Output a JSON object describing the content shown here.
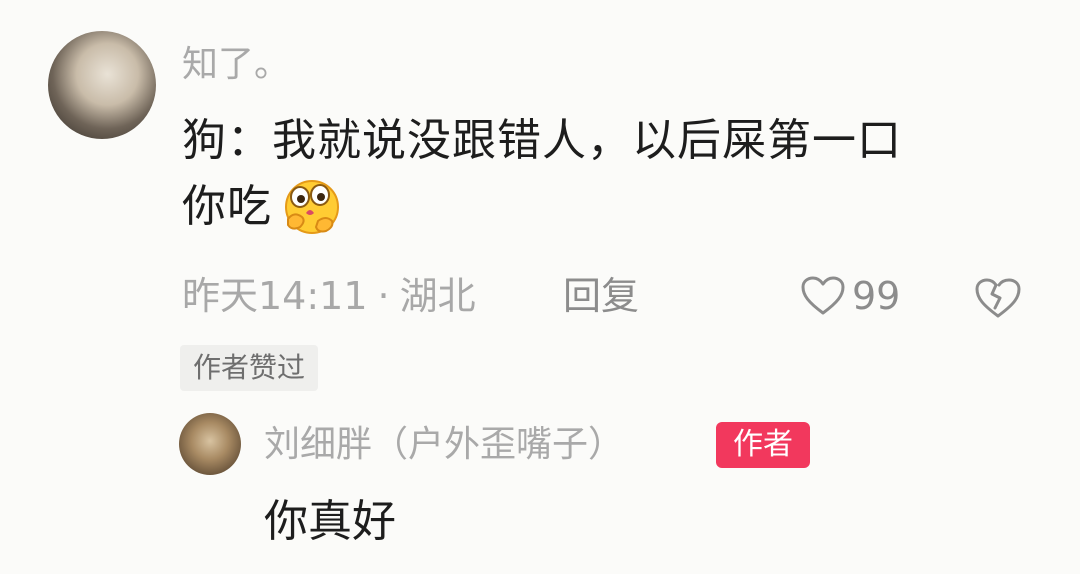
{
  "comment": {
    "username": "知了。",
    "text_line1": "狗：我就说没跟错人，以后屎第一口",
    "text_line2": "你吃",
    "emoji": "thinking-face-emoji",
    "time": "昨天14:11",
    "separator": "·",
    "location": "湖北",
    "reply_label": "回复",
    "like_count": "99",
    "author_liked_badge": "作者赞过"
  },
  "reply": {
    "username": "刘细胖（户外歪嘴子）",
    "author_badge": "作者",
    "text": "你真好"
  },
  "colors": {
    "background": "#fbfbf9",
    "author_badge": "#f2385d",
    "muted_text": "#a9a9a9"
  }
}
